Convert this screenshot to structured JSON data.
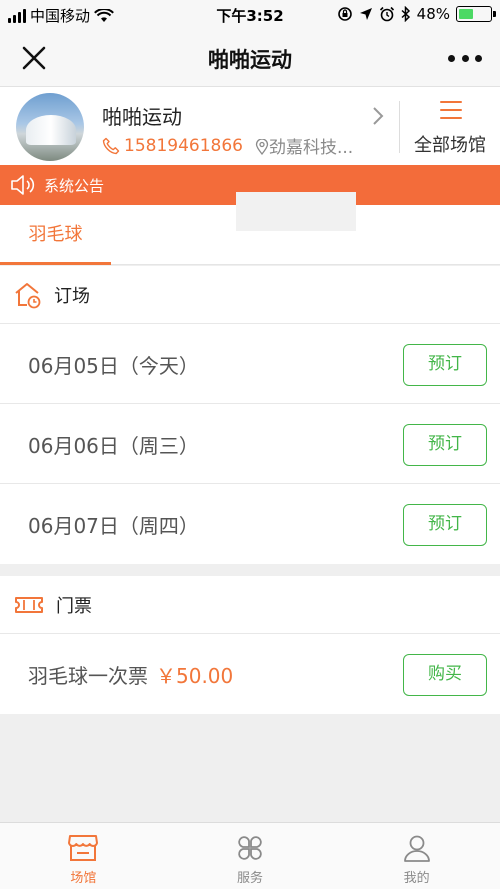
{
  "status_bar": {
    "carrier": "中国移动",
    "time": "下午3:52",
    "battery": "48%",
    "battery_level": 0.48
  },
  "nav": {
    "title": "啪啪运动"
  },
  "venue": {
    "name": "啪啪运动",
    "phone": "15819461866",
    "location": "劲嘉科技...",
    "all_venues_label": "全部场馆"
  },
  "notice": {
    "label": "系统公告"
  },
  "tabs": {
    "active_label": "羽毛球"
  },
  "booking": {
    "title": "订场",
    "rows": [
      {
        "date": "06月05日（今天）",
        "button": "预订"
      },
      {
        "date": "06月06日（周三）",
        "button": "预订"
      },
      {
        "date": "06月07日（周四）",
        "button": "预订"
      }
    ]
  },
  "tickets": {
    "title": "门票",
    "rows": [
      {
        "name": "羽毛球一次票",
        "price": "￥50.00",
        "button": "购买"
      }
    ]
  },
  "tabbar": {
    "items": [
      {
        "label": "场馆",
        "icon": "store-icon",
        "active": true
      },
      {
        "label": "服务",
        "icon": "clover-icon",
        "active": false
      },
      {
        "label": "我的",
        "icon": "user-icon",
        "active": false
      }
    ]
  },
  "colors": {
    "accent": "#f2763a",
    "notice_bg": "#f36c3a",
    "button_green": "#43b649"
  }
}
